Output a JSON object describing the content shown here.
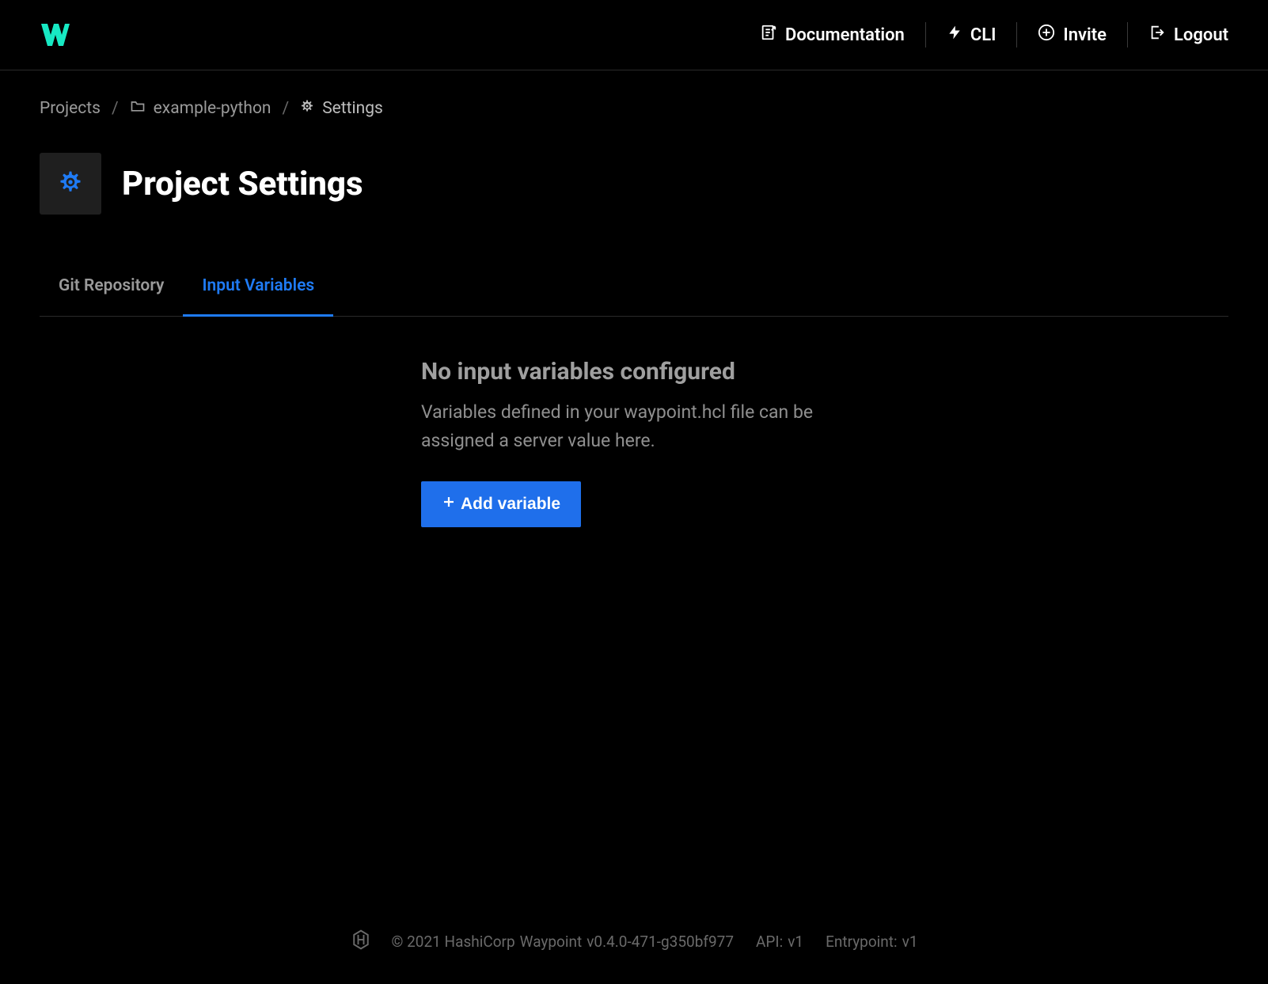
{
  "nav": {
    "documentation": "Documentation",
    "cli": "CLI",
    "invite": "Invite",
    "logout": "Logout"
  },
  "breadcrumb": {
    "projects": "Projects",
    "project_name": "example-python",
    "settings": "Settings"
  },
  "page": {
    "title": "Project Settings"
  },
  "tabs": {
    "git": "Git Repository",
    "input_vars": "Input Variables"
  },
  "empty": {
    "title": "No input variables configured",
    "desc": "Variables defined in your waypoint.hcl file can be assigned a server value here.",
    "button": "Add variable"
  },
  "footer": {
    "copyright_prefix": "© 2021 HashiCorp",
    "product": "Waypoint",
    "version": "v0.4.0-471-g350bf977",
    "api_label": "API:",
    "api_version": "v1",
    "entrypoint_label": "Entrypoint:",
    "entrypoint_version": "v1"
  }
}
